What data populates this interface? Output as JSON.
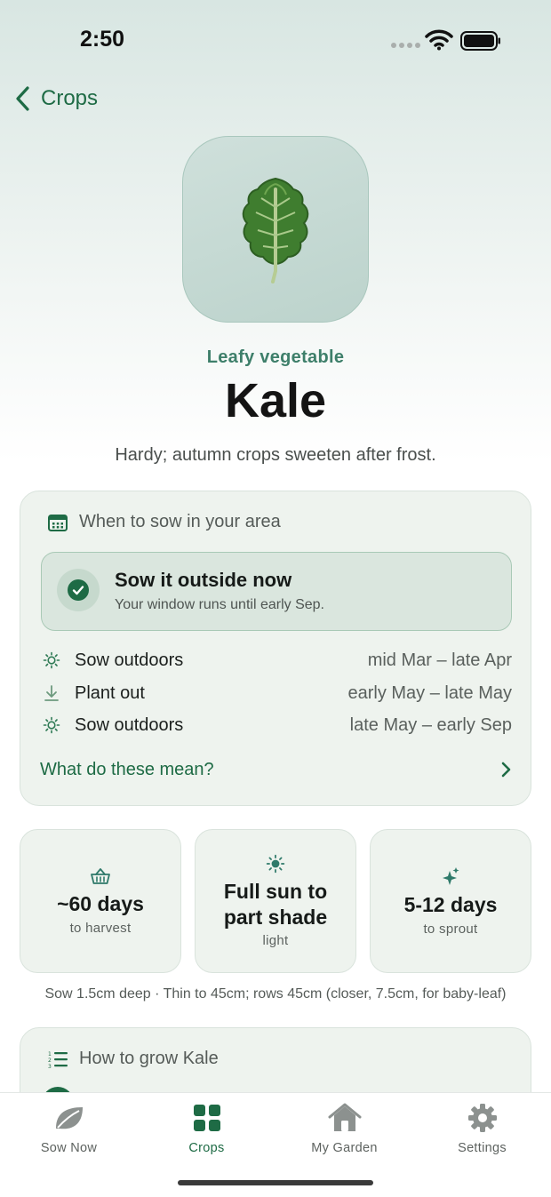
{
  "status_bar": {
    "time": "2:50"
  },
  "nav": {
    "back_label": "Crops"
  },
  "crop": {
    "image_icon": "kale-leaf-icon",
    "category": "Leafy vegetable",
    "name": "Kale",
    "description": "Hardy; autumn crops sweeten after frost."
  },
  "sow_card": {
    "heading": "When to sow in your area",
    "status": {
      "title": "Sow it outside now",
      "subtitle": "Your window runs until early Sep."
    },
    "schedule": [
      {
        "icon": "sun-icon",
        "label": "Sow outdoors",
        "range": "mid Mar – late Apr"
      },
      {
        "icon": "arrow-down-icon",
        "label": "Plant out",
        "range": "early May – late May"
      },
      {
        "icon": "sun-icon",
        "label": "Sow outdoors",
        "range": "late May – early Sep"
      }
    ],
    "help_link": "What do these mean?"
  },
  "stats": [
    {
      "icon": "basket-icon",
      "value": "~60 days",
      "label": "to harvest"
    },
    {
      "icon": "sun-icon",
      "value": "Full sun to part shade",
      "label": "light"
    },
    {
      "icon": "sparkle-icon",
      "value": "5-12 days",
      "label": "to sprout"
    }
  ],
  "sow_note": "Sow 1.5cm deep · Thin to 45cm; rows 45cm (closer, 7.5cm, for baby-leaf)",
  "grow_card": {
    "heading": "How to grow Kale"
  },
  "tab_bar": {
    "active": "Crops",
    "items": [
      {
        "label": "Sow Now",
        "icon": "leaf-icon"
      },
      {
        "label": "Crops",
        "icon": "grid-icon"
      },
      {
        "label": "My Garden",
        "icon": "house-icon"
      },
      {
        "label": "Settings",
        "icon": "gear-icon"
      }
    ]
  },
  "colors": {
    "accent": "#1e6b45",
    "category": "#3e7f6a",
    "card_bg": "#eef3ee"
  }
}
